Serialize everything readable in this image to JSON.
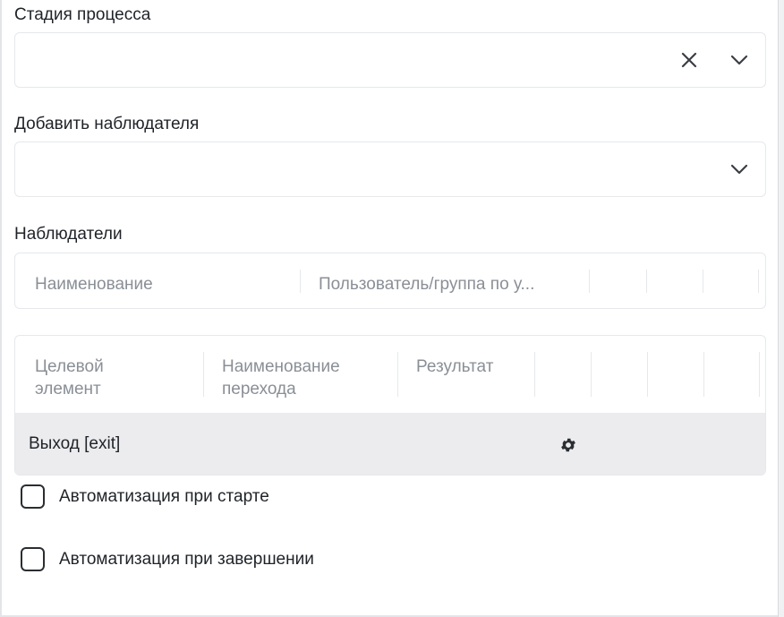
{
  "process_stage": {
    "label": "Стадия процесса",
    "value": ""
  },
  "add_observer": {
    "label": "Добавить наблюдателя",
    "value": ""
  },
  "observers": {
    "label": "Наблюдатели",
    "columns": [
      "Наименование",
      "Пользователь/группа по у..."
    ]
  },
  "transitions": {
    "columns": [
      "Целевой\nэлемент",
      "Наименование\nперехода",
      "Результат"
    ],
    "rows": [
      {
        "target": "Выход [exit]",
        "settings_icon": "gear-icon"
      }
    ]
  },
  "automation_start": {
    "label": "Автоматизация при старте",
    "checked": false
  },
  "automation_end": {
    "label": "Автоматизация при завершении",
    "checked": false
  }
}
